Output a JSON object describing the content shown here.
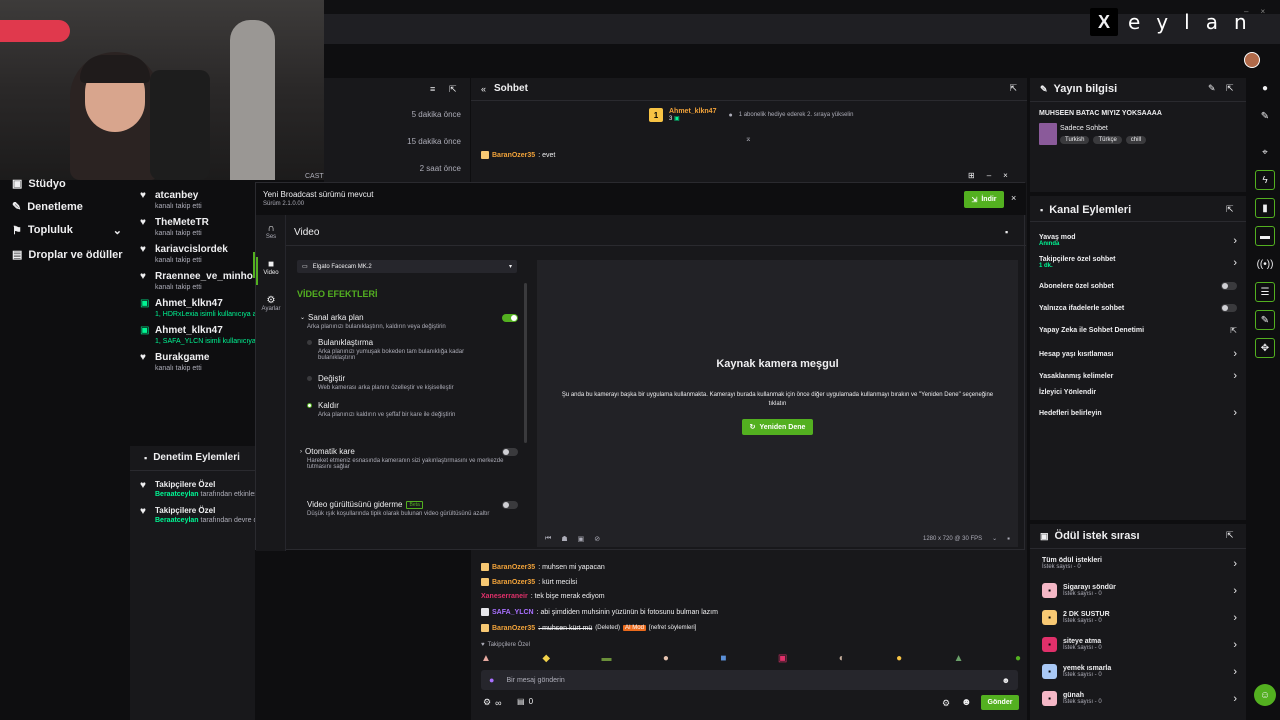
{
  "brand": {
    "name": "Xeylan"
  },
  "left_nav": {
    "items": [
      {
        "label": "Stüdyo"
      },
      {
        "label": "Denetleme"
      },
      {
        "label": "Topluluk"
      },
      {
        "label": "Droplar ve ödüller"
      }
    ]
  },
  "activity": {
    "times": [
      "5 dakika önce",
      "15 dakika önce",
      "2 saat önce"
    ],
    "items": [
      {
        "name": "atcanbey",
        "sub": "kanalı takip etti"
      },
      {
        "name": "TheMeteTR",
        "sub": "kanalı takip etti"
      },
      {
        "name": "kariavcislordek",
        "sub": "kanalı takip etti"
      },
      {
        "name": "Rraennee_ve_minho",
        "sub": "kanalı takip etti"
      },
      {
        "name": "Ahmet_klkn47",
        "sub": "1, HDRxLexia isimli kullanıcıya abo"
      },
      {
        "name": "Ahmet_klkn47",
        "sub": "1, SAFA_YLCN isimli kullanıcıya abo"
      },
      {
        "name": "Burakgame",
        "sub": "kanalı takip etti"
      }
    ]
  },
  "mod_actions": {
    "title": "Denetim Eylemleri",
    "items": [
      {
        "name": "Takipçilere Özel",
        "user": "Beraatceylan",
        "sub": "tarafından etkinleştiri"
      },
      {
        "name": "Takipçilere Özel",
        "user": "Beraatceylan",
        "sub": "tarafından devre dışı"
      }
    ]
  },
  "broadcast": {
    "partial_title": "CAST",
    "banner_title": "Yeni Broadcast sürümü mevcut",
    "banner_version": "Sürüm 2.1.0.00",
    "download_label": "İndir",
    "rail": [
      {
        "label": "Ses"
      },
      {
        "label": "Video"
      },
      {
        "label": "Ayarlar"
      }
    ],
    "section_title": "Video",
    "camera_select": "Elgato Facecam MK.2",
    "effects_title": "VİDEO EFEKTLERİ",
    "virtual_bg": {
      "title": "Sanal arka plan",
      "desc": "Arka planınızı bulanıklaştırın, kaldırın veya değiştirin",
      "on": true
    },
    "options": [
      {
        "title": "Bulanıklaştırma",
        "desc": "Arka planınızı yumuşak bokeden tam bulanıklığa kadar bulanıklaştırın"
      },
      {
        "title": "Değiştir",
        "desc": "Web kamerası arka planını özelleştir ve kişiselleştir"
      },
      {
        "title": "Kaldır",
        "desc": "Arka planınızı kaldırın ve şeffaf bir kare ile değiştirin"
      }
    ],
    "auto_frame": {
      "title": "Otomatik kare",
      "desc": "Hareket etmeniz esnasında kameranın sizi yakınlaştırmasını ve merkezde tutmasını sağlar"
    },
    "noise": {
      "title": "Video gürültüsünü giderme",
      "beta": "Beta",
      "desc": "Düşük ışık koşullarında tipik olarak bulunan video gürültüsünü azaltır"
    },
    "preview": {
      "title": "Kaynak kamera meşgul",
      "desc": "Şu anda bu kamerayı başka bir uygulama kullanmakta. Kamerayı burada kullanmak için önce diğer uygulamada kullanmayı bırakın ve \"Yeniden Dene\" seçeneğine tıklatın",
      "retry": "Yeniden Dene",
      "resolution": "1280 x 720 @ 30 FPS"
    }
  },
  "chat": {
    "title": "Sohbet",
    "pinned": {
      "user": "Ahmet_klkn47",
      "count": "3",
      "text": "1 abonelik hediye ederek 2. sıraya yükselin"
    },
    "top_msg": {
      "user": "BaranOzer35",
      "text": ": evet"
    },
    "messages": [
      {
        "user": "BaranOzer35",
        "text": ": muhsen mi yapacan",
        "color": "#f2a33a"
      },
      {
        "user": "BaranOzer35",
        "text": ": kürt mecilsi",
        "color": "#f2a33a"
      },
      {
        "user": "Xaneserraneir",
        "text": ": tek bişe merak ediyom",
        "color": "#e0306a"
      },
      {
        "user": "SAFA_YLCN",
        "text": ": abi şimdiden muhsinin yüzünün bi fotosunu bulman lazım",
        "color": "#a970ff"
      },
      {
        "user": "BaranOzer35",
        "text": ": muhsen kürt mü",
        "color": "#f2a33a",
        "deleted": "(Deleted)",
        "ai_mod": "AI Mod",
        "tag": "[nefret söylemleri]"
      }
    ],
    "followers_only": "Takipçilere Özel",
    "input_placeholder": "Bir mesaj gönderin",
    "points": "∞",
    "gift_count": "0",
    "send_label": "Gönder"
  },
  "stream_info": {
    "title": "Yayın bilgisi",
    "stream_title": "MUHSEEN BATAC MIYIZ YOKSAAAA",
    "category": "Sadece Sohbet",
    "tags": [
      "Turkish",
      "Türkçe",
      "chill"
    ]
  },
  "channel_actions": {
    "title": "Kanal Eylemleri",
    "items": [
      {
        "label": "Yavaş mod",
        "sub": "Anında",
        "control": "chevron"
      },
      {
        "label": "Takipçilere özel sohbet",
        "sub": "1 dk.",
        "control": "chevron"
      },
      {
        "label": "Abonelere özel sohbet",
        "sub": "",
        "control": "toggle"
      },
      {
        "label": "Yalnızca ifadelerle sohbet",
        "sub": "",
        "control": "toggle"
      },
      {
        "label": "Yapay Zeka ile Sohbet Denetimi",
        "sub": "",
        "control": "external"
      },
      {
        "label": "Hesap yaşı kısıtlaması",
        "sub": "",
        "control": "chevron"
      },
      {
        "label": "Yasaklanmış kelimeler",
        "sub": "",
        "control": "chevron"
      },
      {
        "label": "İzleyici Yönlendir",
        "sub": "",
        "control": "none"
      },
      {
        "label": "Hedefleri belirleyin",
        "sub": "",
        "control": "chevron"
      }
    ]
  },
  "rewards": {
    "title": "Ödül istek sırası",
    "items": [
      {
        "label": "Tüm ödül istekleri",
        "sub": "İstek sayısı - 0",
        "color": ""
      },
      {
        "label": "Sigarayı söndür",
        "sub": "İstek sayısı - 0",
        "color": "#f4b7c6"
      },
      {
        "label": "2 DK SUSTUR",
        "sub": "İstek sayısı - 0",
        "color": "#f7c873"
      },
      {
        "label": "siteye atma",
        "sub": "İstek sayısı - 0",
        "color": "#e0306a"
      },
      {
        "label": "yemek ısmarla",
        "sub": "İstek sayısı - 0",
        "color": "#a9c8f5"
      },
      {
        "label": "günah",
        "sub": "İstek sayısı - 0",
        "color": "#f4b7c6"
      }
    ]
  }
}
